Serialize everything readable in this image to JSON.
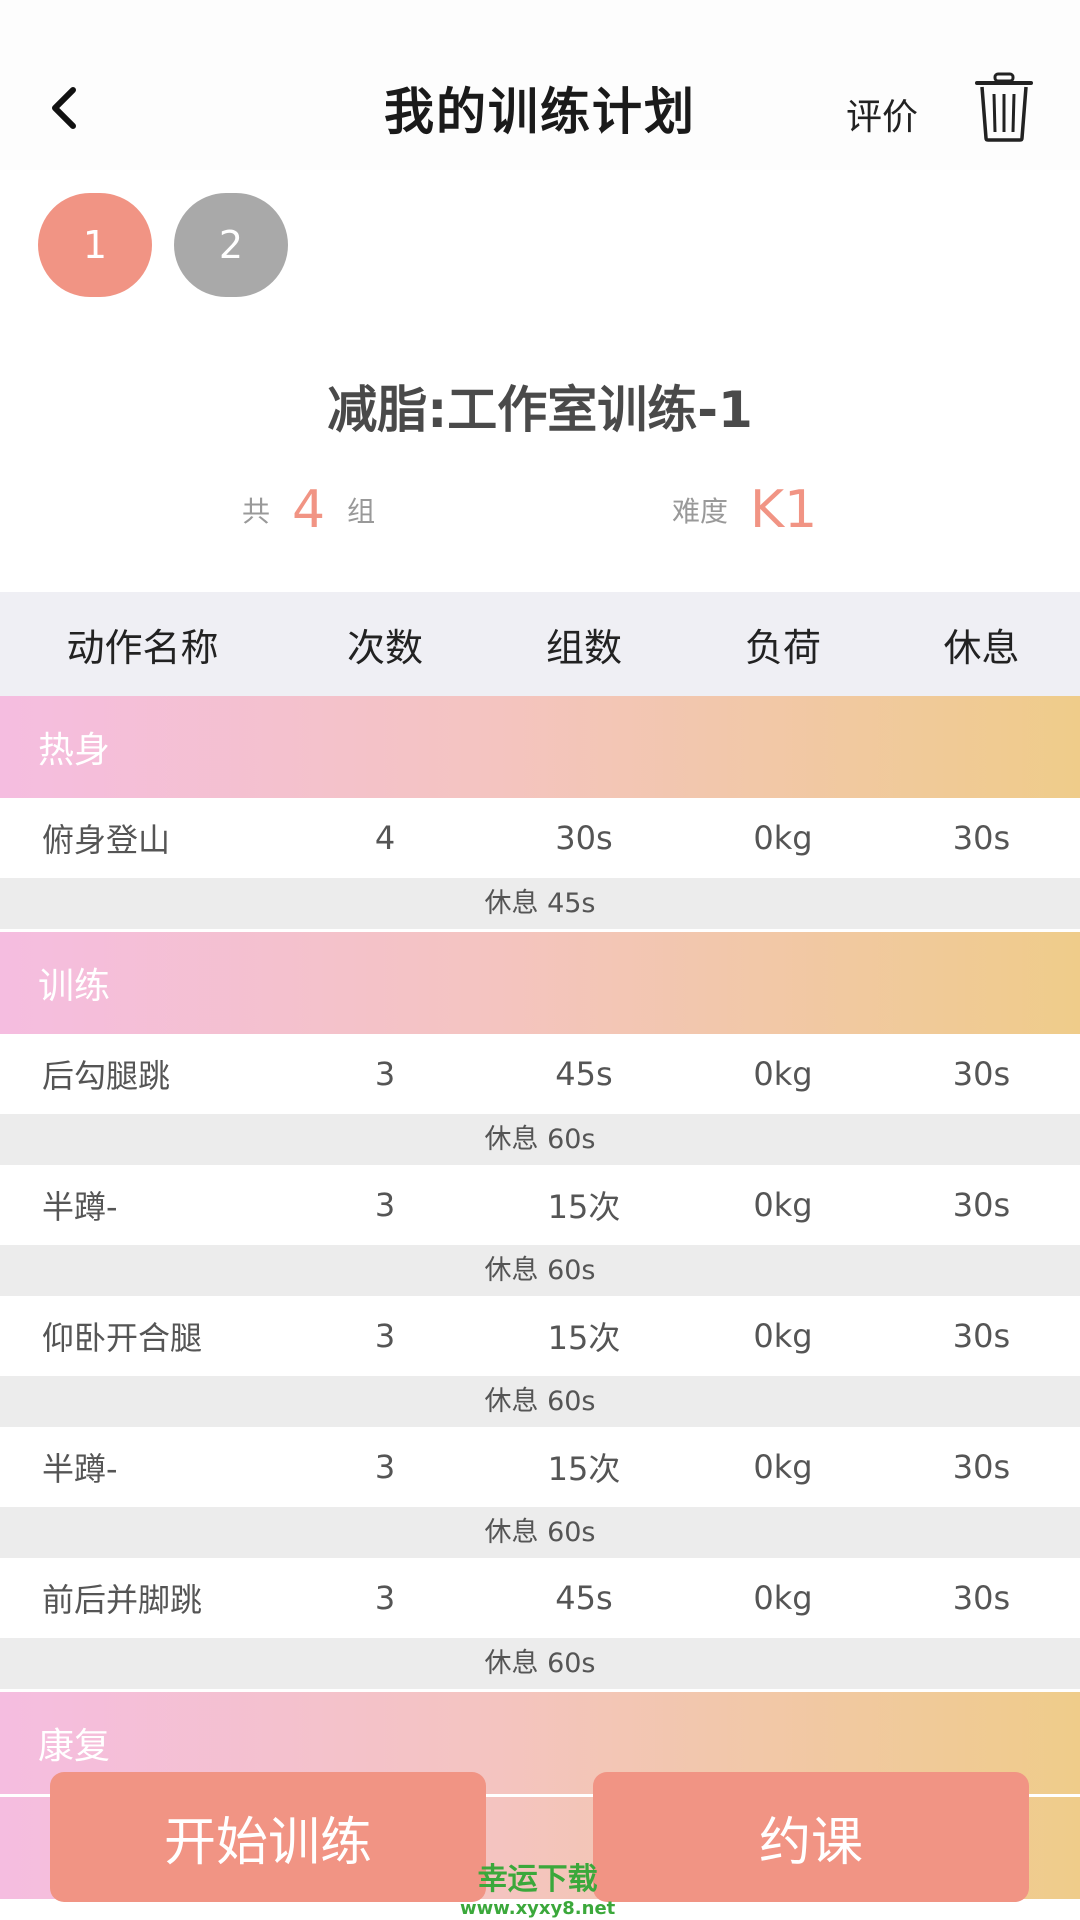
{
  "header": {
    "title": "我的训练计划",
    "rate_label": "评价"
  },
  "days": [
    "1",
    "2"
  ],
  "plan": {
    "name": "减脂:工作室训练-1",
    "total_prefix": "共",
    "total_value": "4",
    "total_suffix": "组",
    "difficulty_label": "难度",
    "difficulty_value": "K1"
  },
  "table": {
    "columns": [
      "动作名称",
      "次数",
      "组数",
      "负荷",
      "休息"
    ]
  },
  "sections": [
    {
      "title": "热身",
      "rows": [
        {
          "name": "俯身登山",
          "reps": "4",
          "sets": "30s",
          "load": "0kg",
          "rest": "30s",
          "after": "休息 45s"
        }
      ]
    },
    {
      "title": "训练",
      "rows": [
        {
          "name": "后勾腿跳",
          "reps": "3",
          "sets": "45s",
          "load": "0kg",
          "rest": "30s",
          "after": "休息 60s"
        },
        {
          "name": "半蹲-",
          "reps": "3",
          "sets": "15次",
          "load": "0kg",
          "rest": "30s",
          "after": "休息 60s"
        },
        {
          "name": "仰卧开合腿",
          "reps": "3",
          "sets": "15次",
          "load": "0kg",
          "rest": "30s",
          "after": "休息 60s"
        },
        {
          "name": "半蹲-",
          "reps": "3",
          "sets": "15次",
          "load": "0kg",
          "rest": "30s",
          "after": "休息 60s"
        },
        {
          "name": "前后并脚跳",
          "reps": "3",
          "sets": "45s",
          "load": "0kg",
          "rest": "30s",
          "after": "休息 60s"
        }
      ]
    },
    {
      "title": "康复",
      "rows": []
    }
  ],
  "buttons": {
    "start": "开始训练",
    "book": "约课"
  },
  "watermark": {
    "title": "幸运下载",
    "url": "www.xyxy8.net"
  },
  "colors": {
    "accent": "#f19484",
    "inactive": "#a9a9a9"
  }
}
